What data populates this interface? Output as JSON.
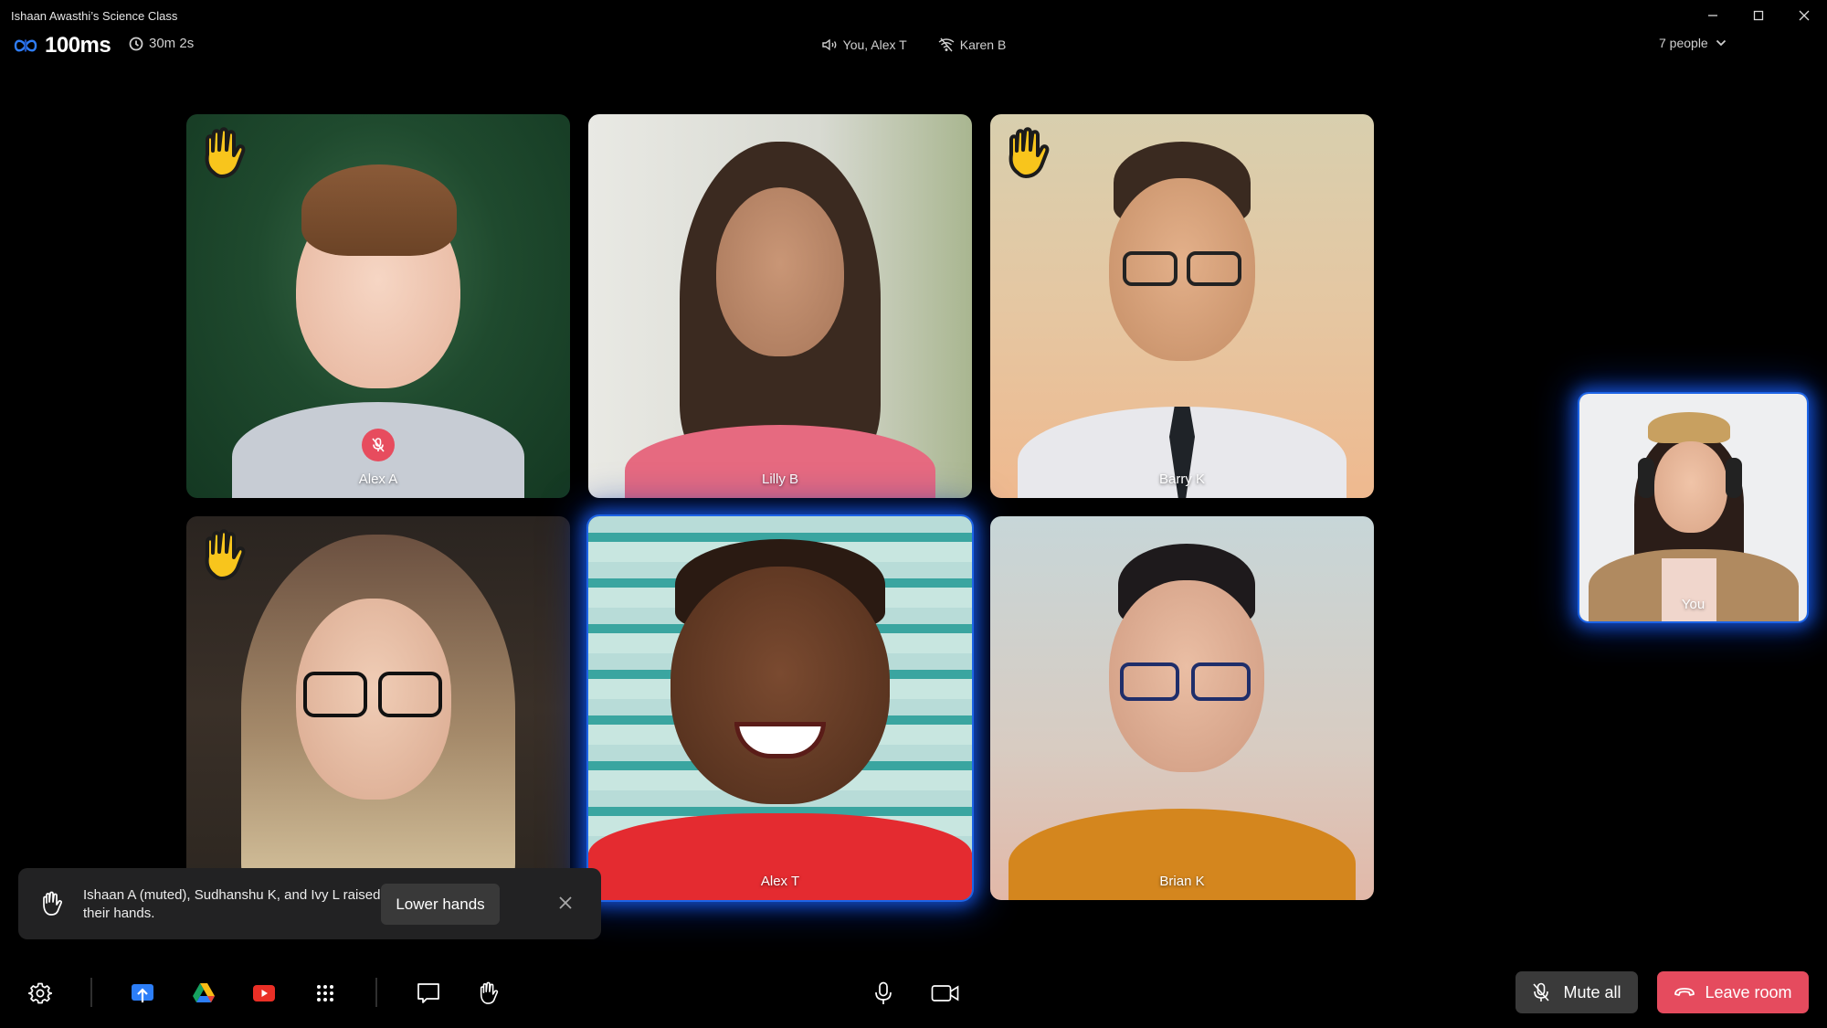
{
  "window": {
    "title": "Ishaan Awasthi’s Science Class",
    "controls": [
      "minimize",
      "maximize",
      "close"
    ]
  },
  "header": {
    "brand": "100ms",
    "elapsed": "30m 2s",
    "speaking": [
      {
        "icon": "speaker-icon",
        "label": "You, Alex T"
      },
      {
        "icon": "network-off-icon",
        "label": "Karen B"
      }
    ],
    "people_count_label": "7 people"
  },
  "tiles": [
    {
      "name": "Alex A",
      "hand_raised": true,
      "muted": true,
      "active_speaker": false
    },
    {
      "name": "Lilly B",
      "hand_raised": false,
      "muted": false,
      "active_speaker": false
    },
    {
      "name": "Barry K",
      "hand_raised": true,
      "muted": false,
      "active_speaker": false
    },
    {
      "name": "",
      "hand_raised": true,
      "muted": false,
      "active_speaker": false
    },
    {
      "name": "Alex T",
      "hand_raised": false,
      "muted": false,
      "active_speaker": true
    },
    {
      "name": "Brian K",
      "hand_raised": false,
      "muted": false,
      "active_speaker": false
    }
  ],
  "self_view": {
    "name": "You",
    "active_speaker": true
  },
  "toast": {
    "message": "Ishaan A (muted), Sudhanshu K, and Ivy L raised their hands.",
    "action_label": "Lower hands"
  },
  "toolbar": {
    "left": [
      "settings-icon",
      "screen-share-icon",
      "google-drive-icon",
      "youtube-icon",
      "apps-grid-icon",
      "chat-icon",
      "raise-hand-icon"
    ],
    "center": [
      "microphone-icon",
      "camera-icon"
    ],
    "mute_all_label": "Mute all",
    "leave_label": "Leave room"
  },
  "colors": {
    "accent_blue": "#1d64e6",
    "leave_red": "#e54b5e",
    "mute_badge": "#e74c5e",
    "hand_yellow": "#f8c51c",
    "toast_bg": "#222223",
    "button_gray": "#3a3a3a"
  }
}
